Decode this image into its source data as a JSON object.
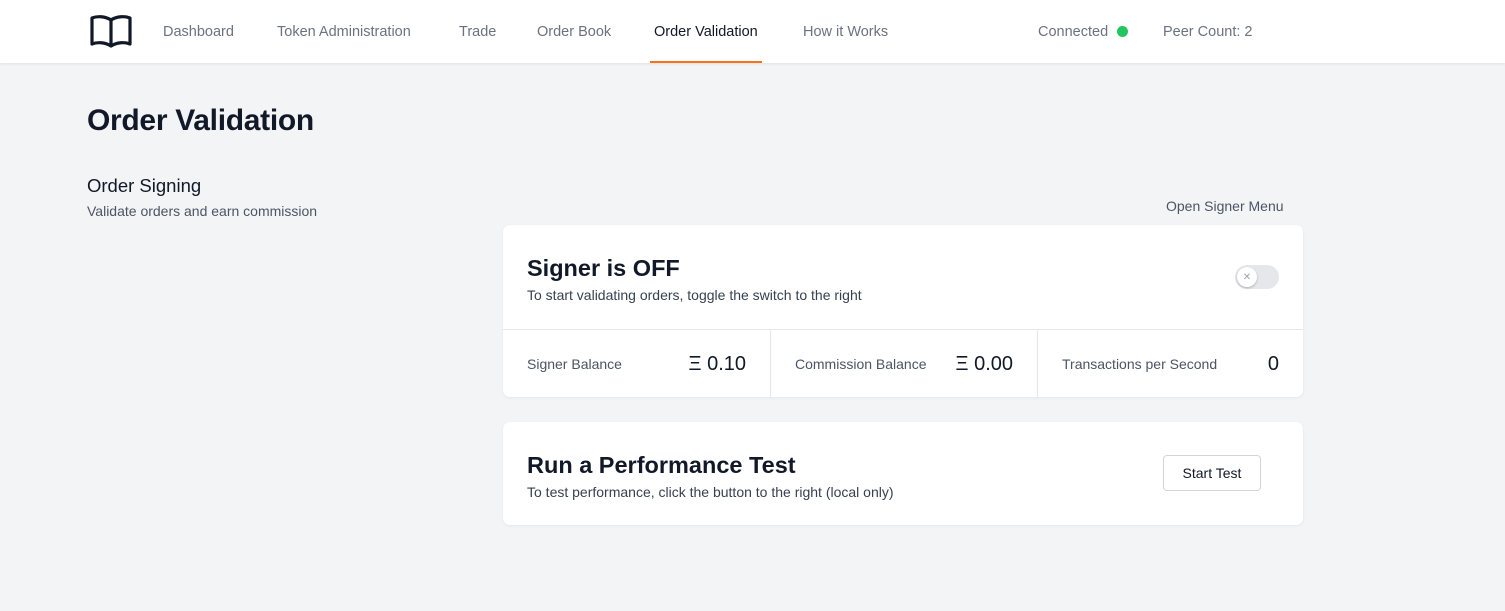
{
  "nav": {
    "items": [
      {
        "label": "Dashboard"
      },
      {
        "label": "Token Administration"
      },
      {
        "label": "Trade"
      },
      {
        "label": "Order Book"
      },
      {
        "label": "Order Validation",
        "active": true
      },
      {
        "label": "How it Works"
      }
    ],
    "connection_label": "Connected",
    "connection_color": "#22c55e",
    "peer_count": "Peer Count: 2",
    "logo_icon": "open-book-icon"
  },
  "page": {
    "title": "Order Validation",
    "section_title": "Order Signing",
    "section_desc": "Validate orders and earn commission",
    "signer_menu_link": "Open Signer Menu"
  },
  "signer_card": {
    "heading": "Signer is OFF",
    "subtext": "To start validating orders, toggle the switch to the right",
    "toggle_on": false,
    "toggle_icon": "x-icon",
    "stats": [
      {
        "label": "Signer Balance",
        "value": "Ξ 0.10"
      },
      {
        "label": "Commission Balance",
        "value": "Ξ 0.00"
      },
      {
        "label": "Transactions per Second",
        "value": "0"
      }
    ]
  },
  "perf_card": {
    "heading": "Run a Performance Test",
    "subtext": "To test performance, click the button to the right (local only)",
    "button_label": "Start Test"
  },
  "colors": {
    "accent": "#f97316",
    "background": "#f3f4f6"
  }
}
